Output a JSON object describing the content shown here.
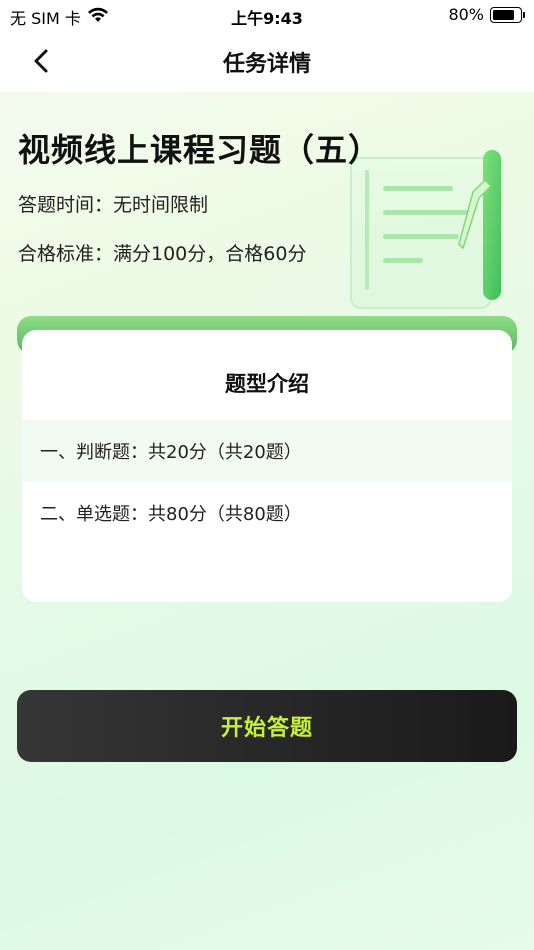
{
  "status_bar": {
    "carrier": "无 SIM 卡",
    "time": "上午9:43",
    "battery_percent": "80%",
    "battery_level": 0.8
  },
  "nav": {
    "title": "任务详情",
    "back_icon": "chevron-left-icon"
  },
  "course": {
    "title": "视频线上课程习题（五）",
    "answer_time": "答题时间：无时间限制",
    "pass_standard": "合格标准：满分100分，合格60分"
  },
  "question_types": {
    "title": "题型介绍",
    "items": [
      {
        "label": "一、判断题：共20分（共20题）"
      },
      {
        "label": "二、单选题：共80分（共80题）"
      }
    ]
  },
  "actions": {
    "start_label": "开始答题"
  },
  "colors": {
    "accent_green": "#59b76a",
    "button_text": "#c6f23a",
    "button_bg": "#222222"
  }
}
